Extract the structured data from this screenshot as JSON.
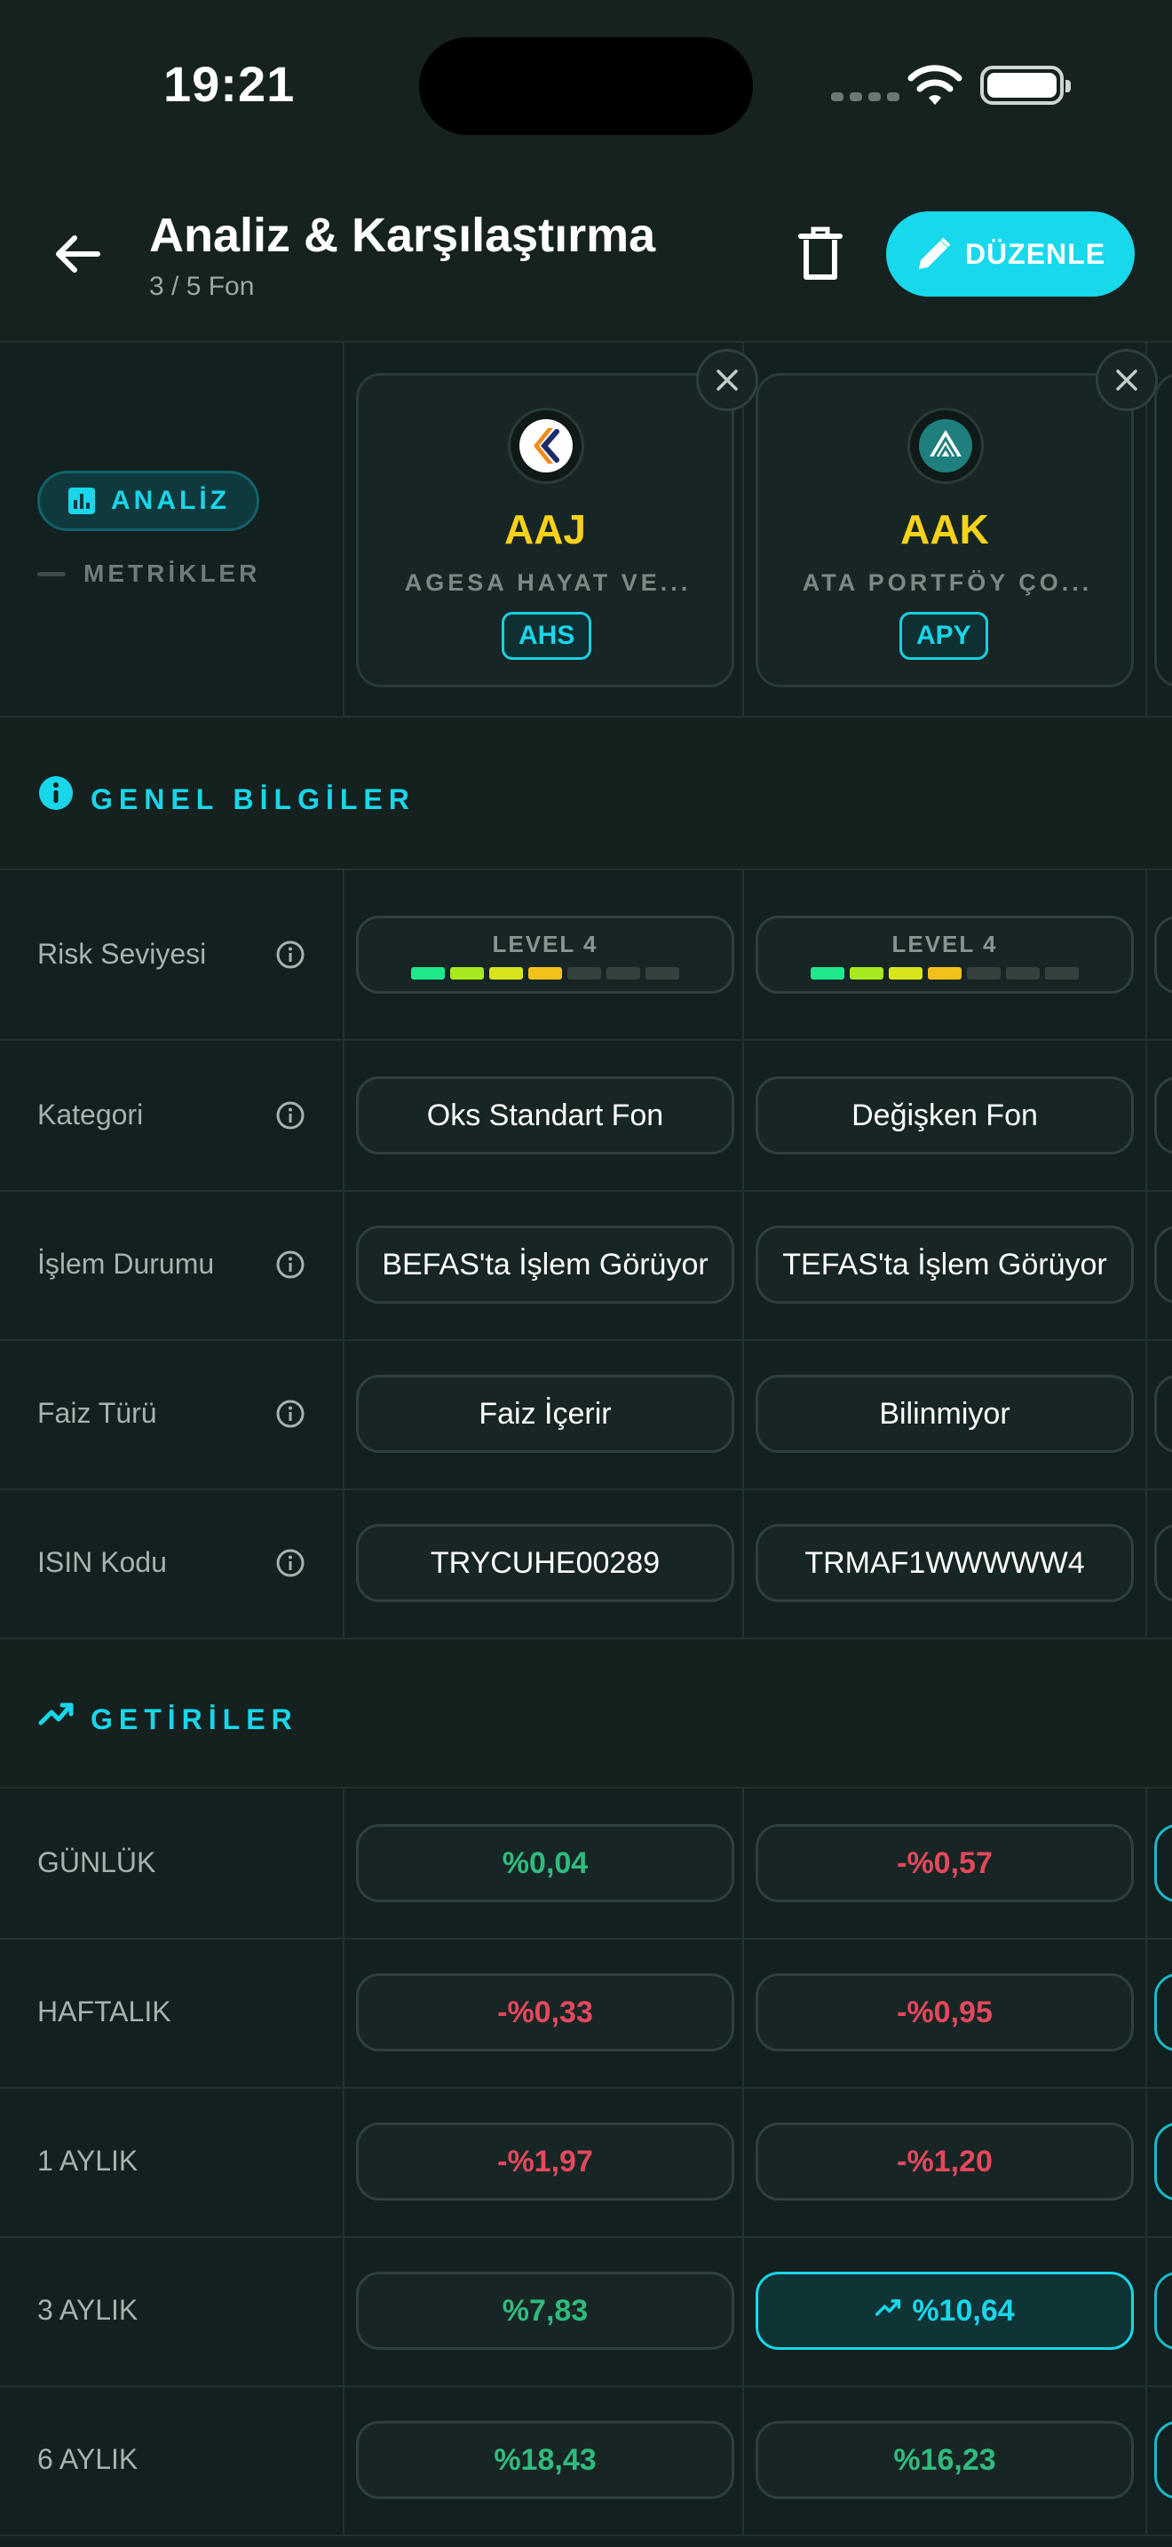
{
  "status_bar": {
    "time": "19:21"
  },
  "header": {
    "title": "Analiz & Karşılaştırma",
    "subtitle": "3 / 5 Fon",
    "edit_label": "DÜZENLE"
  },
  "sidebar": {
    "badge_label": "ANALİZ",
    "metrics_label": "METRİKLER"
  },
  "funds": [
    {
      "code": "AAJ",
      "name": "AGESA HAYAT VE...",
      "tag": "AHS",
      "logo": "agesa-logo"
    },
    {
      "code": "AAK",
      "name": "ATA PORTFÖY ÇO...",
      "tag": "APY",
      "logo": "ata-logo"
    }
  ],
  "sections": {
    "general": "GENEL BİLGİLER",
    "returns": "GETİRİLER"
  },
  "general_rows": [
    {
      "label": "Risk Seviyesi",
      "values": [
        "LEVEL 4",
        "LEVEL 4"
      ],
      "risk_levels": [
        4,
        4
      ],
      "risk_max": 7
    },
    {
      "label": "Kategori",
      "values": [
        "Oks Standart Fon",
        "Değişken Fon"
      ]
    },
    {
      "label": "İşlem Durumu",
      "values": [
        "BEFAS'ta İşlem Görüyor",
        "TEFAS'ta İşlem Görüyor"
      ]
    },
    {
      "label": "Faiz Türü",
      "values": [
        "Faiz İçerir",
        "Bilinmiyor"
      ]
    },
    {
      "label": "ISIN Kodu",
      "values": [
        "TRYCUHE00289",
        "TRMAF1WWWWW4"
      ]
    }
  ],
  "return_rows": [
    {
      "label": "GÜNLÜK",
      "values": [
        "%0,04",
        "-%0,57"
      ],
      "signs": [
        "pos",
        "neg"
      ]
    },
    {
      "label": "HAFTALIK",
      "values": [
        "-%0,33",
        "-%0,95"
      ],
      "signs": [
        "neg",
        "neg"
      ]
    },
    {
      "label": "1 AYLIK",
      "values": [
        "-%1,97",
        "-%1,20"
      ],
      "signs": [
        "neg",
        "neg"
      ]
    },
    {
      "label": "3 AYLIK",
      "values": [
        "%7,83",
        "%10,64"
      ],
      "signs": [
        "pos",
        "best"
      ]
    },
    {
      "label": "6 AYLIK",
      "values": [
        "%18,43",
        "%16,23"
      ],
      "signs": [
        "pos",
        "pos"
      ]
    }
  ],
  "colors": {
    "accent": "#19d6ea",
    "positive": "#2fbb7e",
    "negative": "#e5485d",
    "fund_code": "#f6d21a",
    "risk_scale": [
      "#1de98b",
      "#a8e81f",
      "#d8e41c",
      "#f2c21b",
      "#34413f",
      "#34413f",
      "#34413f"
    ]
  }
}
